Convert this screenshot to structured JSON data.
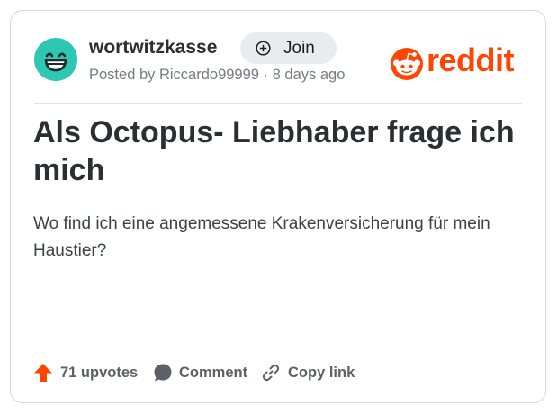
{
  "post": {
    "community": "wortwitzkasse",
    "join_label": "Join",
    "posted_by_prefix": "Posted by ",
    "author": "Riccardo99999",
    "separator": " · ",
    "age": "8 days ago",
    "title": "Als Octopus- Liebhaber frage ich mich",
    "body": "Wo find ich eine angemessene Krakenversicherung für mein Haustier?"
  },
  "brand": {
    "wordmark": "reddit",
    "color": "#ff4500"
  },
  "avatar": {
    "icon": "grinning-face-icon",
    "background": "#2dc7b3"
  },
  "actions": {
    "upvotes_label": "71 upvotes",
    "comment_label": "Comment",
    "copy_link_label": "Copy link",
    "upvote_color": "#ff4500"
  }
}
